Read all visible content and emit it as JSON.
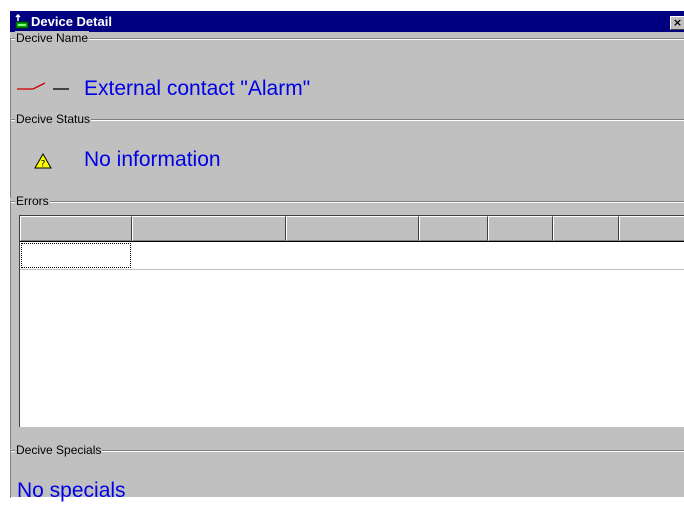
{
  "window": {
    "title": "Device Detail",
    "close_label": "×"
  },
  "device_name": {
    "group_label": "Decive Name",
    "value": "External contact \"Alarm\"",
    "icon": "contact-switch-icon"
  },
  "device_status": {
    "group_label": "Decive Status",
    "value": "No information",
    "icon": "warning-triangle-icon"
  },
  "errors": {
    "group_label": "Errors",
    "columns": [
      "",
      "",
      "",
      "",
      "",
      "",
      ""
    ],
    "rows": []
  },
  "device_specials": {
    "group_label": "Decive Specials",
    "value": "No specials"
  },
  "colors": {
    "titlebar": "#000080",
    "face": "#c0c0c0",
    "value_text": "#0000e6",
    "warning_fill": "#ffff00",
    "contact_line": "#cc0000"
  }
}
